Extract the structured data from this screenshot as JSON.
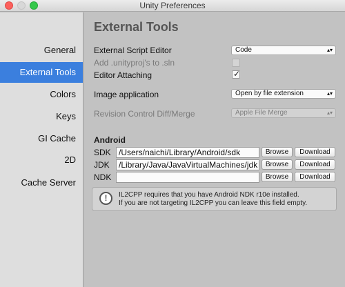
{
  "window": {
    "title": "Unity Preferences"
  },
  "sidebar": {
    "items": [
      {
        "label": "General",
        "selected": false
      },
      {
        "label": "External Tools",
        "selected": true
      },
      {
        "label": "Colors",
        "selected": false
      },
      {
        "label": "Keys",
        "selected": false
      },
      {
        "label": "GI Cache",
        "selected": false
      },
      {
        "label": "2D",
        "selected": false
      },
      {
        "label": "Cache Server",
        "selected": false
      }
    ],
    "selected_color": "#3b7fde"
  },
  "main": {
    "heading": "External Tools",
    "script_editor": {
      "label": "External Script Editor",
      "value": "Code"
    },
    "add_unityproj": {
      "label": "Add .unityproj's to .sln",
      "checked": false,
      "enabled": false
    },
    "editor_attaching": {
      "label": "Editor Attaching",
      "checked": true
    },
    "image_app": {
      "label": "Image application",
      "value": "Open by file extension"
    },
    "revision_diff": {
      "label": "Revision Control Diff/Merge",
      "value": "Apple File Merge",
      "enabled": false
    },
    "android": {
      "section_label": "Android",
      "sdk": {
        "label": "SDK",
        "path": "/Users/naichi/Library/Android/sdk"
      },
      "jdk": {
        "label": "JDK",
        "path": "/Library/Java/JavaVirtualMachines/jdk"
      },
      "ndk": {
        "label": "NDK",
        "path": ""
      },
      "browse_label": "Browse",
      "download_label": "Download"
    },
    "help": {
      "icon": "info-icon",
      "line1": "IL2CPP requires that you have Android NDK r10e installed.",
      "line2": "If you are not targeting IL2CPP you can leave this field empty."
    }
  }
}
